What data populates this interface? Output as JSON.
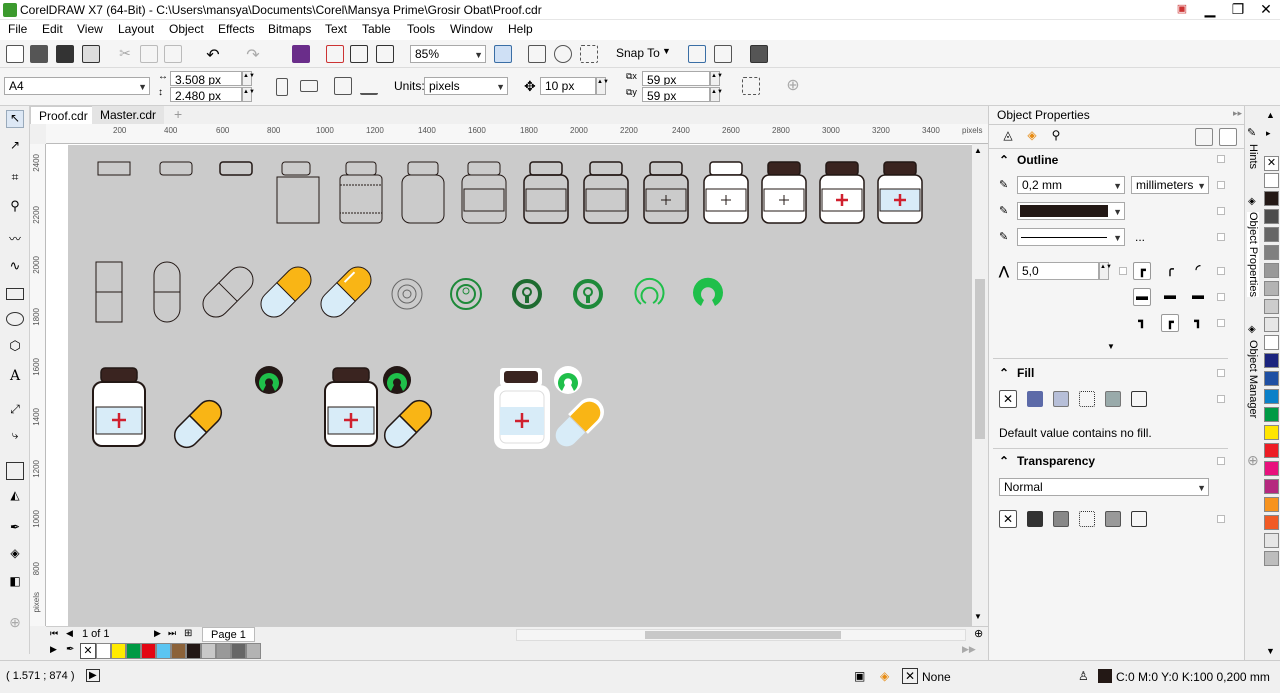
{
  "window": {
    "title": "CorelDRAW X7 (64-Bit) - C:\\Users\\mansya\\Documents\\Corel\\Mansya Prime\\Grosir Obat\\Proof.cdr",
    "controls": [
      "▁",
      "❐",
      "✕"
    ]
  },
  "menu": [
    "File",
    "Edit",
    "View",
    "Layout",
    "Object",
    "Effects",
    "Bitmaps",
    "Text",
    "Table",
    "Tools",
    "Window",
    "Help"
  ],
  "toolbar": {
    "zoom": "85%",
    "snap_to": "Snap To"
  },
  "propertybar": {
    "page_size": "A4",
    "width": "3.508 px",
    "height": "2.480 px",
    "units_label": "Units:",
    "units": "pixels",
    "nudge": "10 px",
    "dup_x": "59 px",
    "dup_y": "59 px"
  },
  "doc_tabs": [
    "Proof.cdr",
    "Master.cdr"
  ],
  "ruler": {
    "h_ticks": [
      "200",
      "400",
      "600",
      "800",
      "1000",
      "1200",
      "1400",
      "1600",
      "1800",
      "2000",
      "2200",
      "2400",
      "2600",
      "2800",
      "3000",
      "3200",
      "3400"
    ],
    "h_unit": "pixels",
    "v_ticks": [
      "2400",
      "2200",
      "2000",
      "1800",
      "1600",
      "1400",
      "1200",
      "1000",
      "800"
    ],
    "v_unit": "pixels"
  },
  "page_nav": {
    "counter": "1 of 1",
    "page_tab": "Page 1"
  },
  "status": {
    "coords": "( 1.571 ; 874 )",
    "fill": "None",
    "outline": "C:0 M:0 Y:0 K:100  0,200 mm"
  },
  "docker": {
    "title": "Object Properties",
    "outline": {
      "heading": "Outline",
      "width": "0,2 mm",
      "units": "millimeters",
      "color": "#231815",
      "miter": "5,0",
      "more": "..."
    },
    "fill": {
      "heading": "Fill",
      "note": "Default value contains no fill."
    },
    "transparency": {
      "heading": "Transparency",
      "mode": "Normal"
    }
  },
  "side_tabs": [
    "Hints",
    "Object Properties",
    "Object Manager"
  ],
  "palette_colors": [
    "#ffffff",
    "#231815",
    "#4d4d4d",
    "#666666",
    "#808080",
    "#999999",
    "#b3b3b3",
    "#cccccc",
    "#e6e6e6",
    "#ffffff",
    "#1a237e",
    "#1e4fa3",
    "#0a80c8",
    "#009a44",
    "#ffe500",
    "#ed1c24",
    "#e8117d",
    "#b5287f",
    "#f7931e",
    "#f15a24",
    "#e6e6e6",
    "#bdbdbd"
  ],
  "bottom_palette": [
    "#ffffff",
    "#ffeb00",
    "#009a44",
    "#e30613",
    "#5bc5f2",
    "#8c6239",
    "#231815",
    "#c8c8c8",
    "#999999",
    "#666666",
    "#b3b3b3"
  ],
  "drawing": {
    "outline": "#231815",
    "jar_lid": "#3a2420",
    "cross": "#d0202e",
    "green": "#1e8a3a",
    "green_light": "#1fbf4a",
    "capsule_yellow": "#f9b515",
    "capsule_blue": "#d8ecf8"
  }
}
